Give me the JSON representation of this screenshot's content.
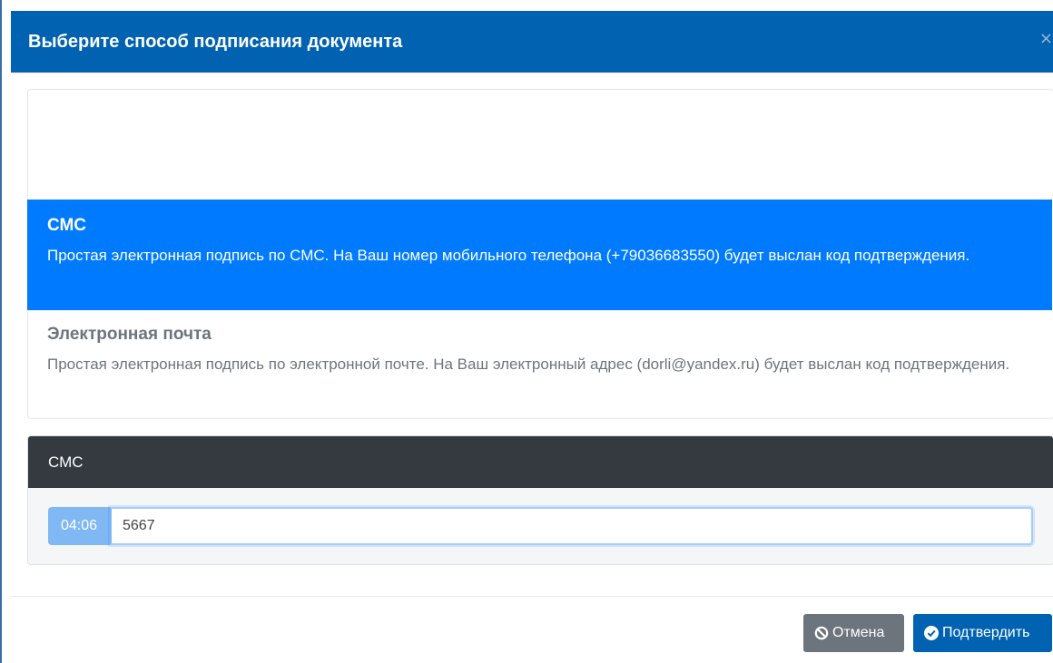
{
  "dialog": {
    "title": "Выберите способ подписания документа",
    "close_symbol": "×"
  },
  "methods": [
    {
      "title": "СМС",
      "description": "Простая электронная подпись по СМС. На Ваш номер мобильного телефона (+79036683550) будет выслан код подтверждения.",
      "active": true
    },
    {
      "title": "Электронная почта",
      "description": "Простая электронная подпись по электронной почте. На Ваш электронный адрес (dorli@yandex.ru) будет выслан код подтверждения.",
      "active": false
    }
  ],
  "sms_card": {
    "header": "СМС",
    "timer": "04:06",
    "code_value": "5667"
  },
  "footer": {
    "cancel_label": "Отмена",
    "cancel_icon": "ban-icon",
    "confirm_label": "Подтвердить",
    "confirm_icon": "check-circle-icon"
  },
  "colors": {
    "header_bg": "#0062b1",
    "active_item_bg": "#007bff",
    "card_header_bg": "#343a40",
    "cancel_bg": "#6c757d",
    "confirm_bg": "#0062b1"
  }
}
